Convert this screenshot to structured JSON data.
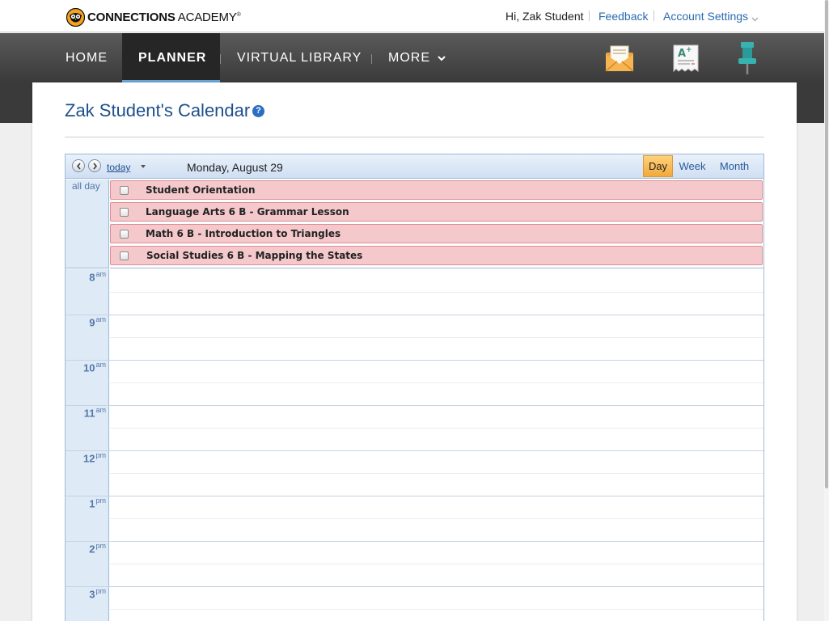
{
  "header": {
    "logo": {
      "brand_bold": "CONNECTIONS",
      "brand_light": "ACADEMY",
      "reg_mark": "®",
      "icon": "owl-logo-icon"
    },
    "greeting": "Hi, Zak Student",
    "feedback_label": "Feedback",
    "account_settings_label": "Account Settings"
  },
  "nav": {
    "items": [
      {
        "label": "HOME"
      },
      {
        "label": "PLANNER",
        "active": true
      },
      {
        "label": "VIRTUAL LIBRARY"
      },
      {
        "label": "MORE"
      }
    ],
    "icons": [
      "message-envelope-icon",
      "grades-receipt-icon",
      "pushpin-icon"
    ]
  },
  "page": {
    "title": "Zak Student's Calendar",
    "help_label": "?"
  },
  "calendar": {
    "today_label": "today",
    "current_date": "Monday, August 29",
    "views": [
      "Day",
      "Week",
      "Month"
    ],
    "active_view": "Day",
    "allday_label": "all day",
    "events": [
      "Student Orientation",
      "Language Arts 6 B - Grammar Lesson",
      "Math 6 B - Introduction to Triangles",
      "Social Studies 6 B - Mapping the States"
    ],
    "hours": [
      {
        "hour": "8",
        "suffix": "am"
      },
      {
        "hour": "9",
        "suffix": "am"
      },
      {
        "hour": "10",
        "suffix": "am"
      },
      {
        "hour": "11",
        "suffix": "am"
      },
      {
        "hour": "12",
        "suffix": "pm"
      },
      {
        "hour": "1",
        "suffix": "pm"
      },
      {
        "hour": "2",
        "suffix": "pm"
      },
      {
        "hour": "3",
        "suffix": "pm"
      }
    ],
    "colors": {
      "event_fill": "#f5c9cc",
      "active_view": "#f2a93b",
      "gutter": "#dfeaf7"
    }
  }
}
